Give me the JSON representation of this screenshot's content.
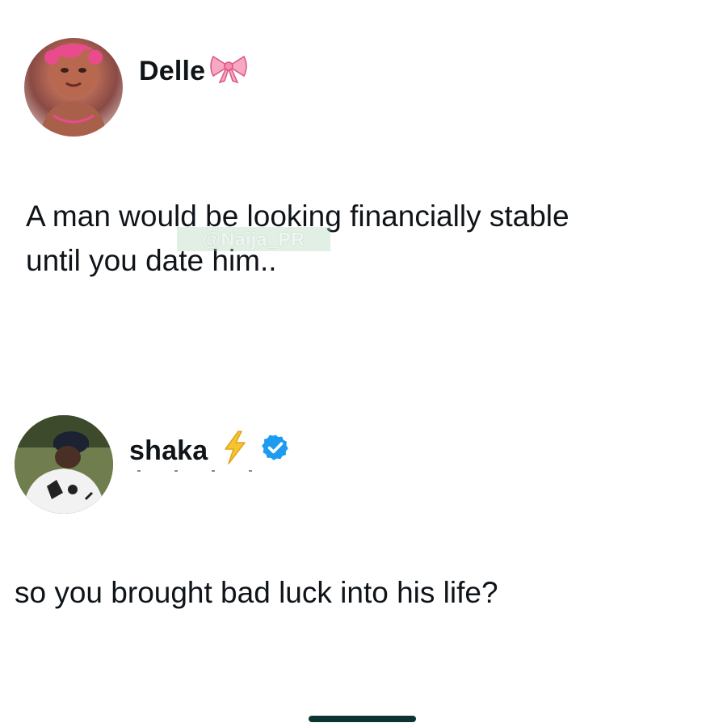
{
  "tweets": [
    {
      "display_name": "Delle",
      "name_emoji": "bow-icon",
      "text_line_1": "A man would be looking financially stable",
      "text_line_2": "until you date him..",
      "avatar": "profile-photo"
    },
    {
      "display_name": "shaka",
      "name_emoji": "lightning-icon",
      "verified_badge": "verified-badge-icon",
      "text": "so you brought bad luck into his life?",
      "avatar": "profile-photo"
    }
  ],
  "watermark": "@Naija_PR",
  "colors": {
    "text": "#0f1419",
    "verified_blue": "#1d9bf0",
    "bow_pink": "#f48fb1",
    "lightning_yellow": "#f5c518",
    "home_indicator": "#0c3431"
  }
}
